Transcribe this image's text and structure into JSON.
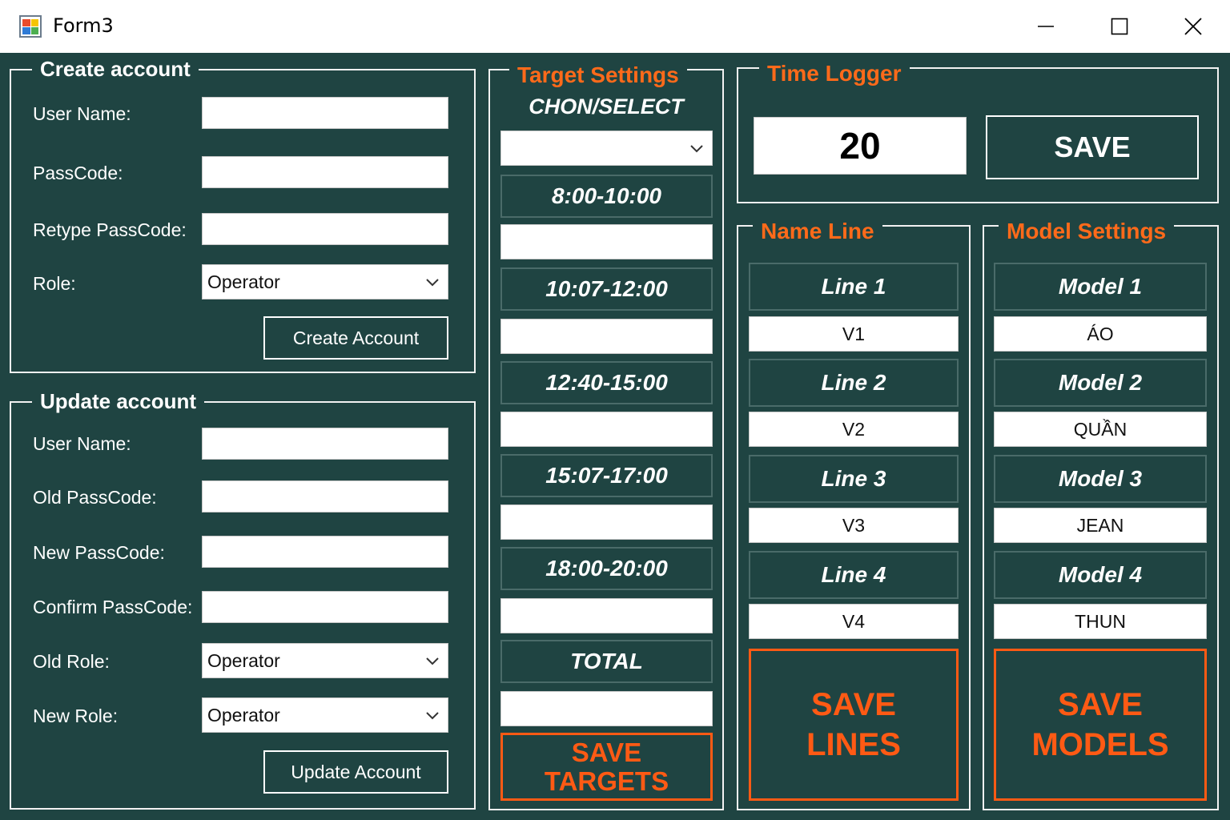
{
  "window": {
    "title": "Form3",
    "icon": "winforms-app-icon",
    "controls": [
      "minimize-icon",
      "maximize-icon",
      "close-icon"
    ]
  },
  "create_account": {
    "title": "Create account",
    "user_name_label": "User Name:",
    "passcode_label": "PassCode:",
    "retype_label": "Retype PassCode:",
    "role_label": "Role:",
    "role_value": "Operator",
    "button": "Create Account"
  },
  "update_account": {
    "title": "Update account",
    "user_name_label": "User Name:",
    "old_passcode_label": "Old PassCode:",
    "new_passcode_label": "New PassCode:",
    "confirm_label": "Confirm PassCode:",
    "old_role_label": "Old Role:",
    "old_role_value": "Operator",
    "new_role_label": "New Role:",
    "new_role_value": "Operator",
    "button": "Update Account"
  },
  "target_settings": {
    "title": "Target Settings",
    "select_label": "CHON/SELECT",
    "slots": [
      "8:00-10:00",
      "10:07-12:00",
      "12:40-15:00",
      "15:07-17:00",
      "18:00-20:00"
    ],
    "total_label": "TOTAL",
    "save_line1": "SAVE",
    "save_line2": "TARGETS"
  },
  "time_logger": {
    "title": "Time Logger",
    "value": "20",
    "save_button": "SAVE"
  },
  "name_line": {
    "title": "Name Line",
    "items": [
      {
        "label": "Line 1",
        "value": "V1"
      },
      {
        "label": "Line 2",
        "value": "V2"
      },
      {
        "label": "Line 3",
        "value": "V3"
      },
      {
        "label": "Line 4",
        "value": "V4"
      }
    ],
    "save_line1": "SAVE",
    "save_line2": "LINES"
  },
  "model_settings": {
    "title": "Model Settings",
    "items": [
      {
        "label": "Model 1",
        "value": "ÁO"
      },
      {
        "label": "Model 2",
        "value": "QUẦN"
      },
      {
        "label": "Model 3",
        "value": "JEAN"
      },
      {
        "label": "Model 4",
        "value": "THUN"
      }
    ],
    "save_line1": "SAVE",
    "save_line2": "MODELS"
  },
  "colors": {
    "background": "#1f4442",
    "accent_orange": "#ff5a14",
    "border": "#f2f2f2"
  }
}
